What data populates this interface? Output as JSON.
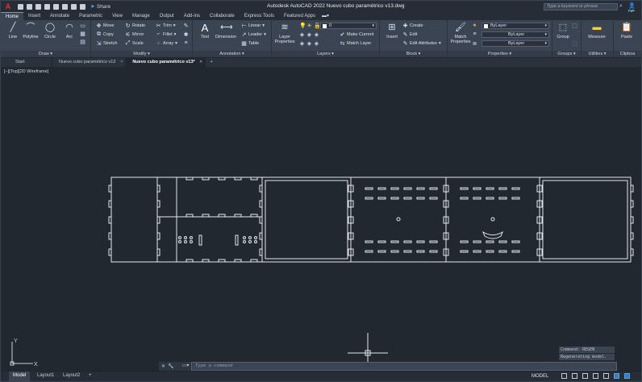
{
  "titlebar": {
    "app_title": "Autodesk AutoCAD 2022    Nuevo cubo paramétrico v13.dwg",
    "share_label": "Share",
    "search_placeholder": "Type a keyword or phrase",
    "user_label": "pe"
  },
  "ribbon_tabs": [
    "Home",
    "Insert",
    "Annotate",
    "Parametric",
    "View",
    "Manage",
    "Output",
    "Add-ins",
    "Collaborate",
    "Express Tools",
    "Featured Apps"
  ],
  "ribbon": {
    "draw": {
      "title": "Draw",
      "line": "Line",
      "polyline": "Polyline",
      "circle": "Circle",
      "arc": "Arc"
    },
    "modify": {
      "title": "Modify",
      "move": "Move",
      "rotate": "Rotate",
      "trim": "Trim",
      "copy": "Copy",
      "mirror": "Mirror",
      "fillet": "Fillet",
      "stretch": "Stretch",
      "scale": "Scale",
      "array": "Array"
    },
    "annotation": {
      "title": "Annotation",
      "text": "Text",
      "dimension": "Dimension",
      "linear": "Linear",
      "leader": "Leader",
      "table": "Table"
    },
    "layers": {
      "title": "Layers",
      "layer_properties": "Layer Properties",
      "layer_value": "0",
      "make_current": "Make Current",
      "match_layer": "Match Layer"
    },
    "block": {
      "title": "Block",
      "insert": "Insert",
      "create": "Create",
      "edit": "Edit",
      "edit_attributes": "Edit Attributes"
    },
    "properties": {
      "title": "Properties",
      "match_properties": "Match Properties",
      "color": "ByLayer",
      "linetype": "ByLayer",
      "lineweight": "ByLayer"
    },
    "groups": {
      "title": "Groups",
      "group": "Group"
    },
    "utilities": {
      "title": "Utilities",
      "measure": "Measure"
    },
    "clipboard": {
      "title": "Clipboa",
      "paste": "Paste"
    }
  },
  "file_tabs": [
    {
      "label": "Start"
    },
    {
      "label": "Nuevo cubo paramétrico v13"
    },
    {
      "label": "Nuevo cubo paramétrico v13*"
    }
  ],
  "viewport": {
    "label": "[−][Top][2D Wireframe]"
  },
  "command_history": [
    "Command: REGEN",
    "Regenerating model."
  ],
  "command_line": {
    "placeholder": "Type a command"
  },
  "layout_tabs": [
    "Model",
    "Layout1",
    "Layout2"
  ],
  "status": {
    "model_label": "MODEL"
  },
  "ucs": {
    "x": "X",
    "y": "Y"
  }
}
